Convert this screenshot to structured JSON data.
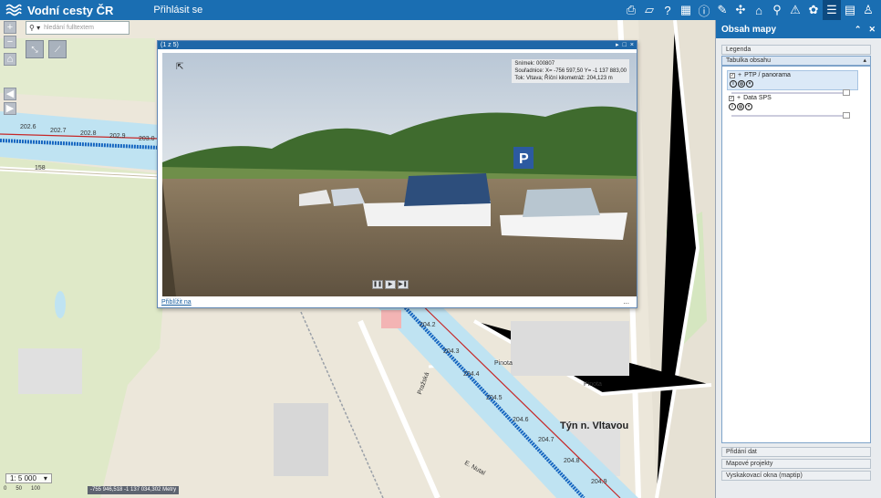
{
  "header": {
    "title": "Vodní cesty ČR",
    "login_label": "Přihlásit se",
    "tool_icons": [
      "print-icon",
      "map-icon",
      "help-icon",
      "grid-icon",
      "info-icon",
      "measure-icon",
      "network-icon",
      "home-icon",
      "search-icon",
      "warning-icon",
      "cycle-icon",
      "layers-icon",
      "list-icon",
      "user-icon"
    ]
  },
  "map": {
    "search_placeholder": "hledání fulltextem",
    "scale_label": "1: 5 000",
    "scalebar": [
      "0",
      "50",
      "100"
    ],
    "coords": "-755 946,518 -1 137 034,302 Metry",
    "km_marks_left": [
      "202.6",
      "202.7",
      "202.8",
      "202.9",
      "203.0"
    ],
    "km_marks_right": [
      "204.2",
      "204.3",
      "204.4",
      "204.5",
      "204.6",
      "204.7",
      "204.8",
      "204.9"
    ],
    "town": "Týn n. Vltavou",
    "road_158": "158",
    "street_labels": [
      "Pražská",
      "Pinota",
      "Pinota",
      "E. Nutal"
    ]
  },
  "panorama": {
    "title": "(1 z 5)",
    "info_lines": [
      "Snímek: 000807",
      "Souřadnice: X= -756 597,50 Y= -1 137 883,00",
      "Tok: Vltava; Říční kilometráž: 204,123 m"
    ],
    "zoom_link": "Přiblížit na",
    "more": "..."
  },
  "panel": {
    "title": "Obsah mapy",
    "legend": "Legenda",
    "toc": "Tabulka obsahu",
    "layers": [
      {
        "name": "PTP / panorama"
      },
      {
        "name": "Data SPS"
      }
    ],
    "bottom_sections": [
      "Přidání dat",
      "Mapové projekty",
      "Vyskakovací okna (maptip)"
    ]
  },
  "colors": {
    "brand": "#1a6eb2",
    "river": "#bfe3f2",
    "river_line": "#1565c0",
    "km_line": "#c62828"
  }
}
